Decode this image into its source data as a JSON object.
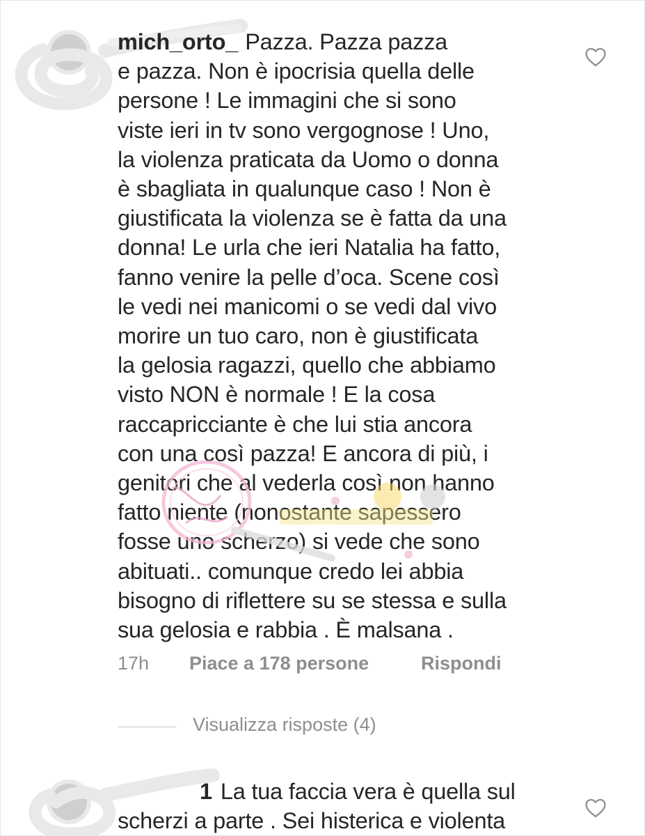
{
  "comments": [
    {
      "username": "mich_orto_",
      "lines": [
        "Pazza. Pazza pazza",
        "e pazza. Non è ipocrisia quella delle",
        "persone ! Le immagini che si sono",
        "viste ieri in tv sono vergognose ! Uno,",
        "la violenza praticata da Uomo o donna",
        "è sbagliata in qualunque caso ! Non è",
        "giustificata la violenza se è fatta da una",
        "donna! Le urla che ieri Natalia ha fatto,",
        "fanno venire la pelle d’oca. Scene così",
        "le vedi nei manicomi o se vedi dal vivo",
        "morire un tuo caro, non è giustificata",
        "la gelosia ragazzi, quello che abbiamo",
        "visto NON è normale ! E la cosa",
        "raccapricciante è che lui stia ancora",
        "con una così pazza! E ancora di più, i",
        "genitori che al vederla così non hanno",
        "fatto niente (nonostante sapessero",
        "fosse uno scherzo) si vede che sono",
        "abituati.. comunque credo lei abbia",
        "bisogno di riflettere su se stessa e sulla",
        "sua gelosia e rabbia . È malsana ."
      ],
      "time": "17h",
      "likes": "Piace a 178 persone",
      "reply": "Rispondi",
      "view_replies": "Visualizza risposte (4)"
    },
    {
      "username": "1",
      "lines": [
        "La tua faccia vera è quella sul",
        "scherzi a parte . Sei histerica e violenta"
      ]
    }
  ],
  "icons": {
    "like": "heart-outline-icon"
  },
  "colors": {
    "text": "#262626",
    "meta": "#8e8e8e",
    "redaction": "#e6e6e6"
  }
}
